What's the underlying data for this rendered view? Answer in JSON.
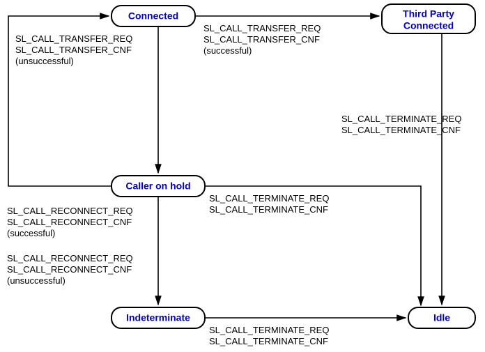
{
  "chart_data": {
    "type": "state-diagram",
    "nodes": [
      {
        "id": "connected",
        "label": "Connected"
      },
      {
        "id": "third_party",
        "label": "Third Party Connected"
      },
      {
        "id": "caller_hold",
        "label": "Caller on hold"
      },
      {
        "id": "indeterminate",
        "label": "Indeterminate"
      },
      {
        "id": "idle",
        "label": "Idle"
      }
    ],
    "edges": [
      {
        "from": "connected",
        "to": "third_party",
        "label": [
          "SL_CALL_TRANSFER_REQ",
          "SL_CALL_TRANSFER_CNF",
          "(successful)"
        ]
      },
      {
        "from": "connected",
        "to": "caller_hold",
        "label": [
          "SL_CALL_TRANSFER_REQ",
          "SL_CALL_TRANSFER_CNF",
          "(unsuccessful)"
        ]
      },
      {
        "from": "caller_hold",
        "to": "connected",
        "label": [
          "SL_CALL_RECONNECT_REQ",
          "SL_CALL_RECONNECT_CNF",
          "(successful)"
        ]
      },
      {
        "from": "caller_hold",
        "to": "indeterminate",
        "label": [
          "SL_CALL_RECONNECT_REQ",
          "SL_CALL_RECONNECT_CNF",
          "(unsuccessful)"
        ]
      },
      {
        "from": "caller_hold",
        "to": "idle",
        "label": [
          "SL_CALL_TERMINATE_REQ",
          "SL_CALL_TERMINATE_CNF"
        ]
      },
      {
        "from": "indeterminate",
        "to": "idle",
        "label": [
          "SL_CALL_TERMINATE_REQ",
          "SL_CALL_TERMINATE_CNF"
        ]
      },
      {
        "from": "third_party",
        "to": "idle",
        "label": [
          "SL_CALL_TERMINATE_REQ",
          "SL_CALL_TERMINATE_CNF"
        ]
      }
    ]
  },
  "nodes": {
    "connected": "Connected",
    "third_party_l1": "Third Party",
    "third_party_l2": "Connected",
    "caller_hold": "Caller on hold",
    "indeterminate": "Indeterminate",
    "idle": "Idle"
  },
  "labels": {
    "transfer_req": "SL_CALL_TRANSFER_REQ",
    "transfer_cnf": "SL_CALL_TRANSFER_CNF",
    "reconnect_req": "SL_CALL_RECONNECT_REQ",
    "reconnect_cnf": "SL_CALL_RECONNECT_CNF",
    "terminate_req": "SL_CALL_TERMINATE_REQ",
    "terminate_cnf": "SL_CALL_TERMINATE_CNF",
    "successful": "(successful)",
    "unsuccessful": "(unsuccessful)"
  }
}
